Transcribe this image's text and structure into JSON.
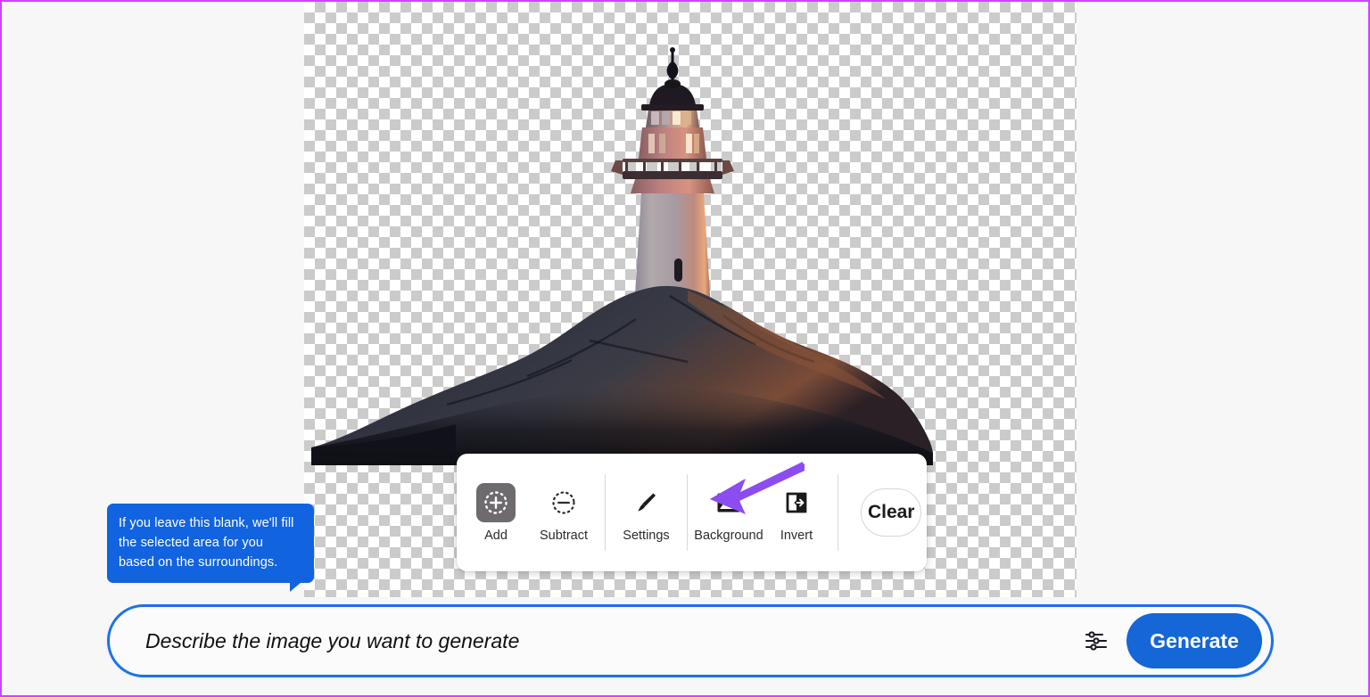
{
  "page": {
    "background_color": "#f7f7f8",
    "border_color": "#cc44ff"
  },
  "canvas": {
    "name": "transparency-canvas",
    "checker_light": "#ffffff",
    "checker_dark": "#cbcbcb",
    "subject": "lighthouse on rocky outcrop, cut out with transparent background"
  },
  "tooltip": {
    "text": "If you leave this blank, we'll fill the selected area for you based on the surroundings.",
    "background_color": "#1263e0",
    "text_color": "#ffffff"
  },
  "toolbar": {
    "tools": [
      {
        "id": "add",
        "label": "Add",
        "icon": "dashed-circle-plus-icon",
        "selected": true
      },
      {
        "id": "subtract",
        "label": "Subtract",
        "icon": "dashed-circle-minus-icon",
        "selected": false
      },
      {
        "id": "settings",
        "label": "Settings",
        "icon": "paintbrush-icon",
        "selected": false
      },
      {
        "id": "background",
        "label": "Background",
        "icon": "image-mountain-icon",
        "selected": false
      },
      {
        "id": "invert",
        "label": "Invert",
        "icon": "invert-arrows-icon",
        "selected": false
      }
    ],
    "clear_label": "Clear",
    "selected_tool_bg": "#6e6a6d"
  },
  "annotation": {
    "arrow_color": "#8b4cf0",
    "points_to": "Background"
  },
  "prompt": {
    "placeholder": "Describe the image you want to generate",
    "value": "",
    "settings_icon": "sliders-icon",
    "generate_label": "Generate",
    "border_color": "#1a73e8",
    "button_color": "#1566d6"
  }
}
